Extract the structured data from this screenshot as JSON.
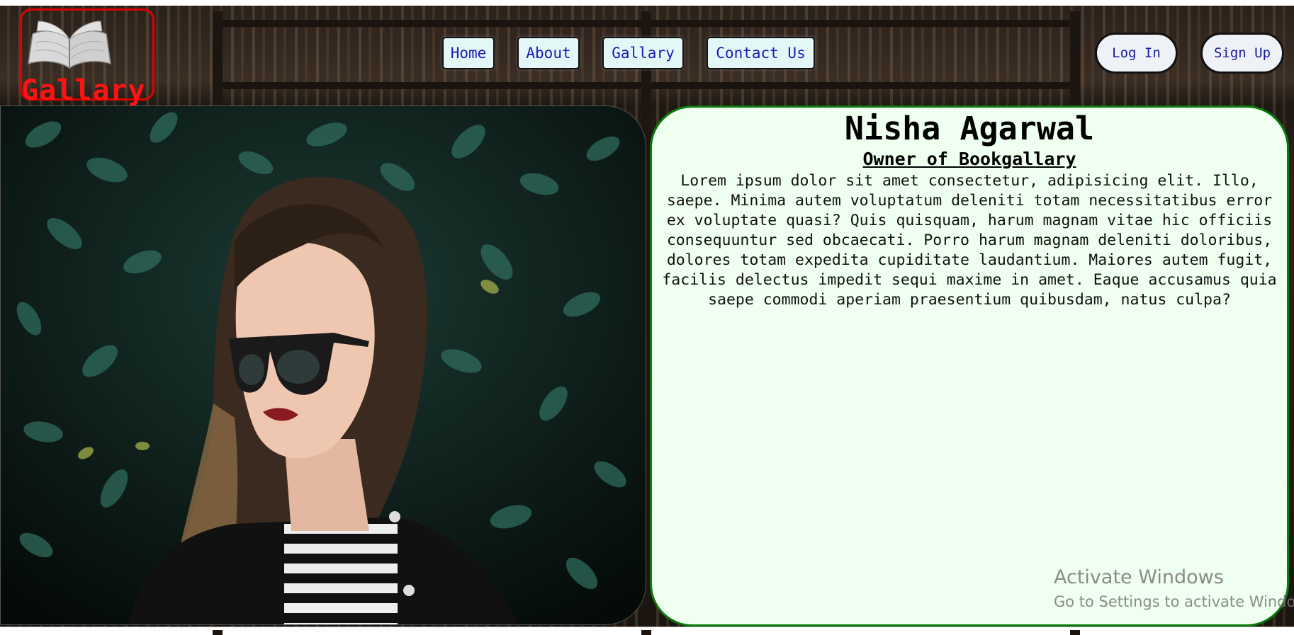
{
  "header": {
    "logo_text": "Gallary",
    "logo_icon": "open-book-icon"
  },
  "nav": {
    "items": [
      {
        "label": "Home"
      },
      {
        "label": "About"
      },
      {
        "label": "Gallary"
      },
      {
        "label": "Contact Us"
      }
    ]
  },
  "auth": {
    "login_label": "Log In",
    "signup_label": "Sign Up"
  },
  "profile": {
    "photo_alt": "woman-with-sunglasses-photo",
    "name": "Nisha Agarwal",
    "role": "Owner of Bookgallary",
    "bio": "Lorem ipsum dolor sit amet consectetur, adipisicing elit. Illo, saepe. Minima autem voluptatum deleniti totam necessitatibus error ex voluptate quasi? Quis quisquam, harum magnam vitae hic officiis consequuntur sed obcaecati. Porro harum magnam deleniti doloribus, dolores totam expedita cupiditate laudantium. Maiores autem fugit, facilis delectus impedit sequi maxime in amet. Eaque accusamus quia saepe commodi aperiam praesentium quibusdam, natus culpa?"
  },
  "watermark": {
    "title": "Activate Windows",
    "subtitle": "Go to Settings to activate Windows."
  },
  "colors": {
    "logo_red": "#ff1212",
    "nav_bg": "#e3f7f7",
    "nav_text": "#1a1ab8",
    "card_bg": "#effff0",
    "card_border": "#0a7a0a"
  }
}
